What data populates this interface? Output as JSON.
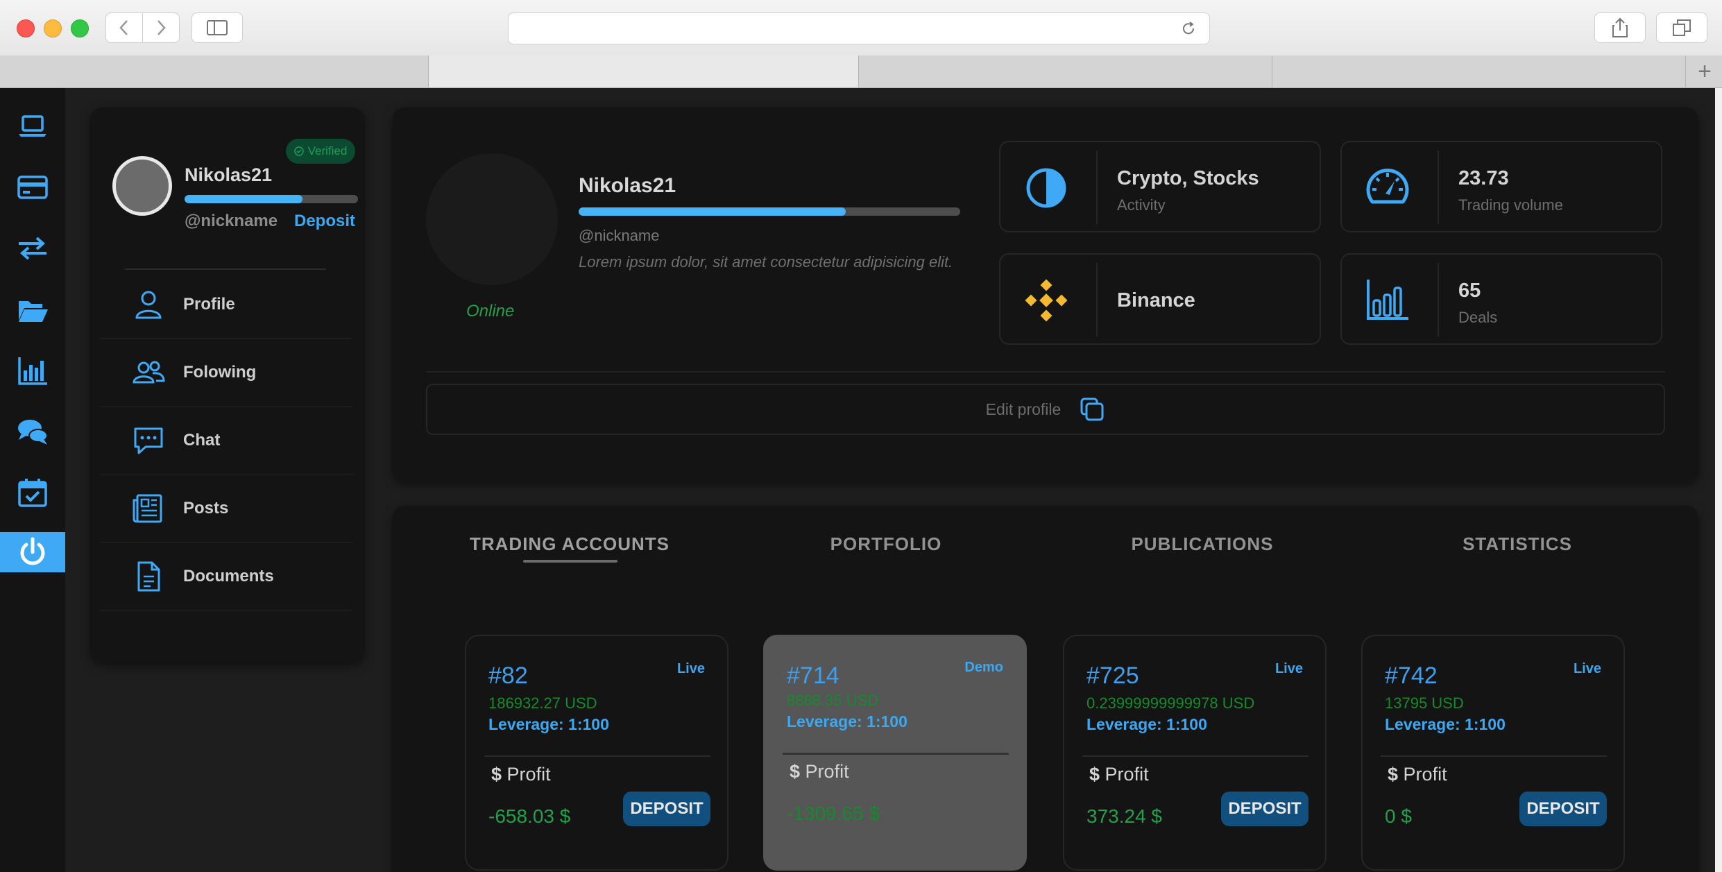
{
  "browser": {
    "new_tab_glyph": "+"
  },
  "rail": {
    "items": [
      "laptop-icon",
      "credit-card-icon",
      "transfer-icon",
      "folder-icon",
      "bar-chart-icon",
      "chat-bubbles-icon",
      "calendar-check-icon",
      "power-icon"
    ],
    "active_index": 7,
    "accent": "#3fa9f5"
  },
  "sidebar": {
    "verified_label": "Verified",
    "username": "Nikolas21",
    "nickname": "@nickname",
    "deposit_link": "Deposit",
    "level_progress": 0.68,
    "menu": [
      {
        "label": "Profile",
        "icon": "user-icon"
      },
      {
        "label": "Folowing",
        "icon": "users-icon"
      },
      {
        "label": "Chat",
        "icon": "chat-icon"
      },
      {
        "label": "Posts",
        "icon": "news-icon"
      },
      {
        "label": "Documents",
        "icon": "document-icon"
      }
    ]
  },
  "profile": {
    "username": "Nikolas21",
    "nickname": "@nickname",
    "description": "Lorem ipsum dolor, sit amet consectetur adipisicing elit.",
    "status": "Online",
    "level_progress": 0.7,
    "stats": [
      {
        "value": "Crypto, Stocks",
        "label": "Activity",
        "icon": "half-circle-icon"
      },
      {
        "value": "23.73",
        "label": "Trading volume",
        "icon": "speedometer-icon"
      },
      {
        "value": "Binance",
        "label": "",
        "icon": "binance-icon"
      },
      {
        "value": "65",
        "label": "Deals",
        "icon": "bar-chart-icon"
      }
    ],
    "edit_label": "Edit profile"
  },
  "tabs": {
    "items": [
      "TRADING ACCOUNTS",
      "PORTFOLIO",
      "PUBLICATIONS",
      "STATISTICS"
    ],
    "active_index": 0
  },
  "accounts": [
    {
      "id": "#82",
      "type": "Live",
      "balance": "186932.27 USD",
      "leverage": "Leverage: 1:100",
      "profit_label": "Profit",
      "profit": "-658.03 $",
      "deposit": "DEPOSIT"
    },
    {
      "id": "#714",
      "type": "Demo",
      "balance": "8868.35 USD",
      "leverage": "Leverage: 1:100",
      "profit_label": "Profit",
      "profit": "-1309.65 $",
      "deposit": ""
    },
    {
      "id": "#725",
      "type": "Live",
      "balance": "0.23999999999978 USD",
      "leverage": "Leverage: 1:100",
      "profit_label": "Profit",
      "profit": "373.24 $",
      "deposit": "DEPOSIT"
    },
    {
      "id": "#742",
      "type": "Live",
      "balance": "13795 USD",
      "leverage": "Leverage: 1:100",
      "profit_label": "Profit",
      "profit": "0 $",
      "deposit": "DEPOSIT"
    }
  ],
  "currency_symbol": "$"
}
